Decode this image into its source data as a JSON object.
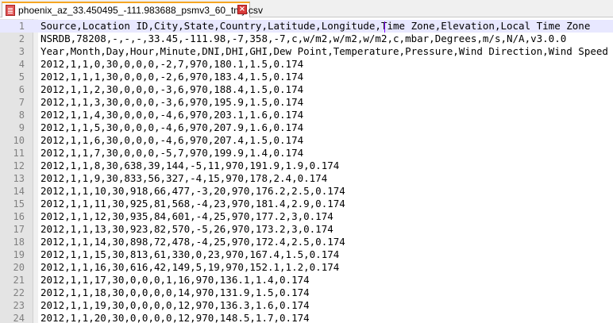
{
  "tab": {
    "title": "phoenix_az_33.450495_-111.983688_psmv3_60_tmy.csv",
    "close_glyph": "×",
    "icon": "file-icon"
  },
  "editor": {
    "lines": [
      {
        "num": "1",
        "text": "Source,Location ID,City,State,Country,Latitude,Longitude,Time Zone,Elevation,Local Time Zone"
      },
      {
        "num": "2",
        "text": "NSRDB,78208,-,-,-,33.45,-111.98,-7,358,-7,c,w/m2,w/m2,w/m2,c,mbar,Degrees,m/s,N/A,v3.0.0"
      },
      {
        "num": "3",
        "text": "Year,Month,Day,Hour,Minute,DNI,DHI,GHI,Dew Point,Temperature,Pressure,Wind Direction,Wind Speed"
      },
      {
        "num": "4",
        "text": "2012,1,1,0,30,0,0,0,-2,7,970,180.1,1.5,0.174"
      },
      {
        "num": "5",
        "text": "2012,1,1,1,30,0,0,0,-2,6,970,183.4,1.5,0.174"
      },
      {
        "num": "6",
        "text": "2012,1,1,2,30,0,0,0,-3,6,970,188.4,1.5,0.174"
      },
      {
        "num": "7",
        "text": "2012,1,1,3,30,0,0,0,-3,6,970,195.9,1.5,0.174"
      },
      {
        "num": "8",
        "text": "2012,1,1,4,30,0,0,0,-4,6,970,203.1,1.6,0.174"
      },
      {
        "num": "9",
        "text": "2012,1,1,5,30,0,0,0,-4,6,970,207.9,1.6,0.174"
      },
      {
        "num": "10",
        "text": "2012,1,1,6,30,0,0,0,-4,6,970,207.4,1.5,0.174"
      },
      {
        "num": "11",
        "text": "2012,1,1,7,30,0,0,0,-5,7,970,199.9,1.4,0.174"
      },
      {
        "num": "12",
        "text": "2012,1,1,8,30,638,39,144,-5,11,970,191.9,1.9,0.174"
      },
      {
        "num": "13",
        "text": "2012,1,1,9,30,833,56,327,-4,15,970,178,2.4,0.174"
      },
      {
        "num": "14",
        "text": "2012,1,1,10,30,918,66,477,-3,20,970,176.2,2.5,0.174"
      },
      {
        "num": "15",
        "text": "2012,1,1,11,30,925,81,568,-4,23,970,181.4,2.9,0.174"
      },
      {
        "num": "16",
        "text": "2012,1,1,12,30,935,84,601,-4,25,970,177.2,3,0.174"
      },
      {
        "num": "17",
        "text": "2012,1,1,13,30,923,82,570,-5,26,970,173.2,3,0.174"
      },
      {
        "num": "18",
        "text": "2012,1,1,14,30,898,72,478,-4,25,970,172.4,2.5,0.174"
      },
      {
        "num": "19",
        "text": "2012,1,1,15,30,813,61,330,0,23,970,167.4,1.5,0.174"
      },
      {
        "num": "20",
        "text": "2012,1,1,16,30,616,42,149,5,19,970,152.1,1.2,0.174"
      },
      {
        "num": "21",
        "text": "2012,1,1,17,30,0,0,0,1,16,970,136.1,1.4,0.174"
      },
      {
        "num": "22",
        "text": "2012,1,1,18,30,0,0,0,0,14,970,131.9,1.5,0.174"
      },
      {
        "num": "23",
        "text": "2012,1,1,19,30,0,0,0,0,12,970,136.3,1.6,0.174"
      },
      {
        "num": "24",
        "text": "2012,1,1,20,30,0,0,0,0,12,970,148.5,1.7,0.174"
      }
    ]
  }
}
